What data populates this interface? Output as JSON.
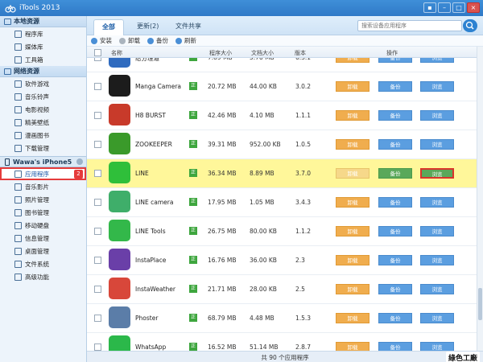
{
  "titlebar": {
    "title": "iTools 2013"
  },
  "tabs": {
    "all": "全部",
    "updates": "更新(2)",
    "file_share": "文件共享"
  },
  "search": {
    "placeholder": "搜索设备应用程序"
  },
  "sidebar": {
    "local_header": "本地资源",
    "local_items": [
      "程序库",
      "媒体库",
      "工具箱"
    ],
    "net_header": "网络资源",
    "net_items": [
      "软件游戏",
      "音乐铃声",
      "电影视频",
      "精美壁纸",
      "漫画图书",
      "下载管理"
    ],
    "device_header": "Wawa's iPhone5",
    "device_items": [
      "应用程序",
      "音乐影片",
      "照片管理",
      "图书管理",
      "移动硬盘",
      "信息管理",
      "桌面管理",
      "文件系统",
      "高级功能"
    ],
    "active_badge": "2"
  },
  "actionbar": {
    "install": "安装",
    "uninstall": "卸载",
    "backup": "备份",
    "refresh": "刷新"
  },
  "table": {
    "headers": {
      "name": "名称",
      "size": "程序大小",
      "docsize": "文档大小",
      "version": "版本",
      "actions": "操作"
    },
    "genuine_label": "正",
    "btn_uninstall": "卸载",
    "btn_backup": "备份",
    "btn_browse": "浏览",
    "rows": [
      {
        "name": "给分理道",
        "size": "7.89 MB",
        "docsize": "5.76 MB",
        "version": "6.3.1",
        "color": "#2f6bbf"
      },
      {
        "name": "Manga Camera",
        "size": "20.72 MB",
        "docsize": "44.00 KB",
        "version": "3.0.2",
        "color": "#1c1c1c"
      },
      {
        "name": "H8 BURST",
        "size": "42.46 MB",
        "docsize": "4.10 MB",
        "version": "1.1.1",
        "color": "#c83a2a"
      },
      {
        "name": "ZOOKEEPER",
        "size": "39.31 MB",
        "docsize": "952.00 KB",
        "version": "1.0.5",
        "color": "#3a9a2a"
      },
      {
        "name": "LINE",
        "size": "36.34 MB",
        "docsize": "8.89 MB",
        "version": "3.7.0",
        "color": "#2fbf3a"
      },
      {
        "name": "LINE camera",
        "size": "17.95 MB",
        "docsize": "1.05 MB",
        "version": "3.4.3",
        "color": "#3fae6a"
      },
      {
        "name": "LINE Tools",
        "size": "26.75 MB",
        "docsize": "80.00 KB",
        "version": "1.1.2",
        "color": "#33b84a"
      },
      {
        "name": "InstaPlace",
        "size": "16.76 MB",
        "docsize": "36.00 KB",
        "version": "2.3",
        "color": "#6a3fa8"
      },
      {
        "name": "InstaWeather",
        "size": "21.71 MB",
        "docsize": "28.00 KB",
        "version": "2.5",
        "color": "#d8473a"
      },
      {
        "name": "Phoster",
        "size": "68.79 MB",
        "docsize": "4.48 MB",
        "version": "1.5.3",
        "color": "#5b7da8"
      },
      {
        "name": "WhatsApp",
        "size": "16.52 MB",
        "docsize": "51.14 MB",
        "version": "2.8.7",
        "color": "#2bb84a"
      }
    ]
  },
  "status": {
    "count_text": "共 90 个应用程序",
    "watermark": "綠色工廠"
  }
}
